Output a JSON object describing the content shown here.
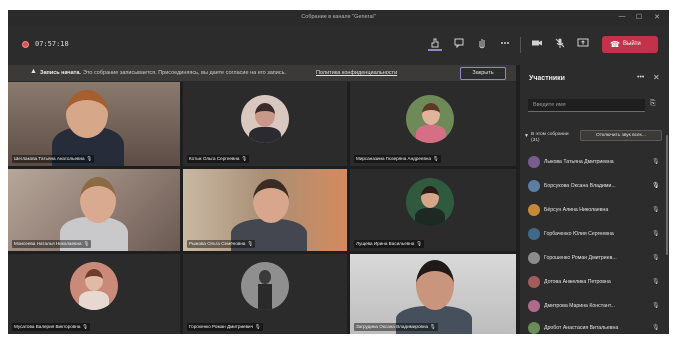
{
  "window": {
    "title": "Собрание в канале \"General\"",
    "min_icon": "—",
    "max_icon": "☐",
    "close_icon": "✕"
  },
  "toolbar": {
    "timer": "07:57:18",
    "leave_label": "Выйти",
    "colors": {
      "leave": "#c4314b",
      "recording": "#d9534f"
    }
  },
  "banner": {
    "title": "Запись начата.",
    "message": "Это собрание записывается. Присоединяясь, вы даете согласие на его запись.",
    "privacy_link": "Политика конфиденциальности",
    "dismiss_label": "Закрыть"
  },
  "tiles": [
    {
      "name": "Шеглакова Татьяна Анатольевна",
      "kind": "camera"
    },
    {
      "name": "Котык Ольга Сергеевна",
      "kind": "avatar"
    },
    {
      "name": "Мирсаназина Гюзеряна Андреевна",
      "kind": "avatar"
    },
    {
      "name": "Моисеева Наталья Николаевна",
      "kind": "camera"
    },
    {
      "name": "Рыжова Ольга Семёновна",
      "kind": "camera"
    },
    {
      "name": "Лущева Ирина Васильевна",
      "kind": "avatar"
    },
    {
      "name": "Мусатова Валерия Викторовна",
      "kind": "avatar"
    },
    {
      "name": "Горохенко Роман Дмитриевич",
      "kind": "avatar"
    },
    {
      "name": "Загрудина Оксана Владимировна",
      "kind": "camera"
    }
  ],
  "panel": {
    "title": "Участники",
    "invite_placeholder": "Введите имя",
    "section_label": "В этом собрании (31)",
    "mute_all_label": "Отключить звук всех...",
    "participants": [
      {
        "name": "Лыкова Татьяна Дмитриевна"
      },
      {
        "name": "Борсукова Оксана Владими..."
      },
      {
        "name": "Бёрсун Алина Николаевна"
      },
      {
        "name": "Горбаченко Юлия Сергеевна"
      },
      {
        "name": "Горошенко Роман Дмитриев..."
      },
      {
        "name": "Дотова Анжелика Петровна"
      },
      {
        "name": "Дмитрова Марина Констант..."
      },
      {
        "name": "Дробот Анастасия Витальевна"
      }
    ]
  }
}
